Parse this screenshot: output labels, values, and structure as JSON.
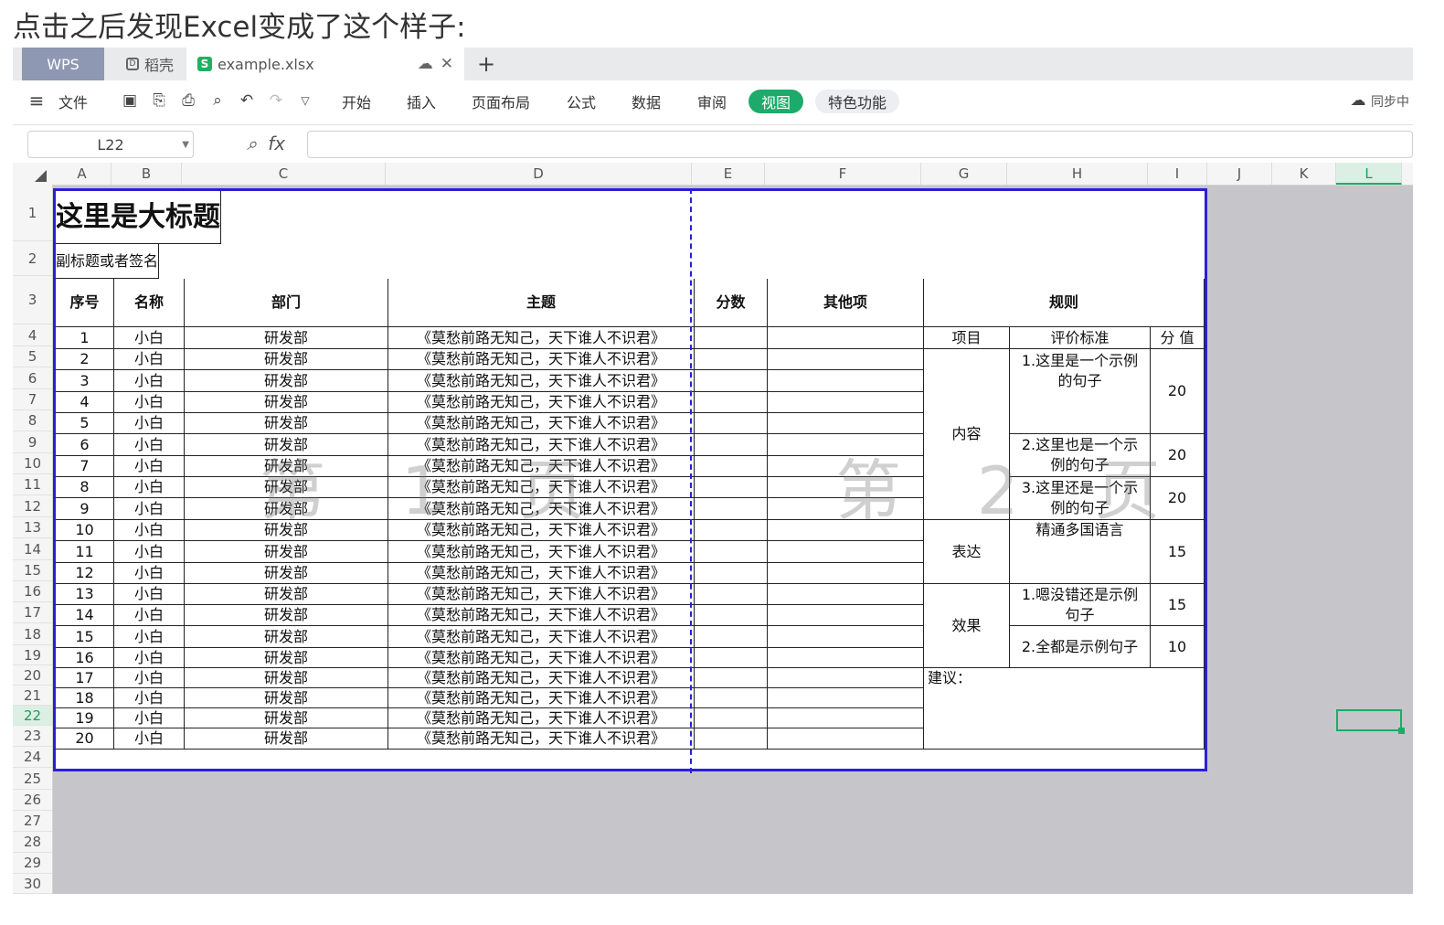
{
  "caption": "点击之后发现Excel变成了这个样子:",
  "tabs": {
    "wps": "WPS",
    "daoke": "稻壳",
    "file": "example.xlsx",
    "plus": "+"
  },
  "menu": {
    "file": "文件",
    "items": [
      "开始",
      "插入",
      "页面布局",
      "公式",
      "数据",
      "审阅"
    ],
    "active": "视图",
    "special": "特色功能",
    "sync": "同步中"
  },
  "formula_bar": {
    "cell_ref": "L22",
    "fx": "fx",
    "value": ""
  },
  "columns": [
    "A",
    "B",
    "C",
    "D",
    "E",
    "F",
    "G",
    "H",
    "I",
    "J",
    "K",
    "L"
  ],
  "rows": [
    "1",
    "2",
    "3",
    "4",
    "5",
    "6",
    "7",
    "8",
    "9",
    "10",
    "11",
    "12",
    "13",
    "14",
    "15",
    "16",
    "17",
    "18",
    "19",
    "20",
    "21",
    "22",
    "23",
    "24",
    "25",
    "26",
    "27",
    "28",
    "29",
    "30"
  ],
  "table": {
    "title": "这里是大标题",
    "subtitle": "副标题或者签名",
    "headers": [
      "序号",
      "名称",
      "部门",
      "主题",
      "分数",
      "其他项",
      "规则"
    ],
    "rule_headers": [
      "项目",
      "评价标准",
      "分  值"
    ],
    "rows": [
      [
        "1",
        "小白",
        "研发部",
        "《莫愁前路无知己，天下谁人不识君》"
      ],
      [
        "2",
        "小白",
        "研发部",
        "《莫愁前路无知己，天下谁人不识君》"
      ],
      [
        "3",
        "小白",
        "研发部",
        "《莫愁前路无知己，天下谁人不识君》"
      ],
      [
        "4",
        "小白",
        "研发部",
        "《莫愁前路无知己，天下谁人不识君》"
      ],
      [
        "5",
        "小白",
        "研发部",
        "《莫愁前路无知己，天下谁人不识君》"
      ],
      [
        "6",
        "小白",
        "研发部",
        "《莫愁前路无知己，天下谁人不识君》"
      ],
      [
        "7",
        "小白",
        "研发部",
        "《莫愁前路无知己，天下谁人不识君》"
      ],
      [
        "8",
        "小白",
        "研发部",
        "《莫愁前路无知己，天下谁人不识君》"
      ],
      [
        "9",
        "小白",
        "研发部",
        "《莫愁前路无知己，天下谁人不识君》"
      ],
      [
        "10",
        "小白",
        "研发部",
        "《莫愁前路无知己，天下谁人不识君》"
      ],
      [
        "11",
        "小白",
        "研发部",
        "《莫愁前路无知己，天下谁人不识君》"
      ],
      [
        "12",
        "小白",
        "研发部",
        "《莫愁前路无知己，天下谁人不识君》"
      ],
      [
        "13",
        "小白",
        "研发部",
        "《莫愁前路无知己，天下谁人不识君》"
      ],
      [
        "14",
        "小白",
        "研发部",
        "《莫愁前路无知己，天下谁人不识君》"
      ],
      [
        "15",
        "小白",
        "研发部",
        "《莫愁前路无知己，天下谁人不识君》"
      ],
      [
        "16",
        "小白",
        "研发部",
        "《莫愁前路无知己，天下谁人不识君》"
      ],
      [
        "17",
        "小白",
        "研发部",
        "《莫愁前路无知己，天下谁人不识君》"
      ],
      [
        "18",
        "小白",
        "研发部",
        "《莫愁前路无知己，天下谁人不识君》"
      ],
      [
        "19",
        "小白",
        "研发部",
        "《莫愁前路无知己，天下谁人不识君》"
      ],
      [
        "20",
        "小白",
        "研发部",
        "《莫愁前路无知己，天下谁人不识君》"
      ]
    ],
    "rules": {
      "content": "内容",
      "c1": "1.这里是一个示例的句子",
      "c1_score": "20",
      "c2": "2.这里也是一个示例的句子",
      "c2_score": "20",
      "c3": "3.这里还是一个示例的句子",
      "c3_score": "20",
      "expression": "表达",
      "e1": "精通多国语言",
      "e1_score": "15",
      "effect": "效果",
      "f1": "1.嗯没错还是示例句子",
      "f1_score": "15",
      "f2": "2.全都是示例句子",
      "f2_score": "10",
      "suggest": "建议："
    }
  },
  "watermarks": [
    "第 1 页",
    "第 2 页"
  ]
}
